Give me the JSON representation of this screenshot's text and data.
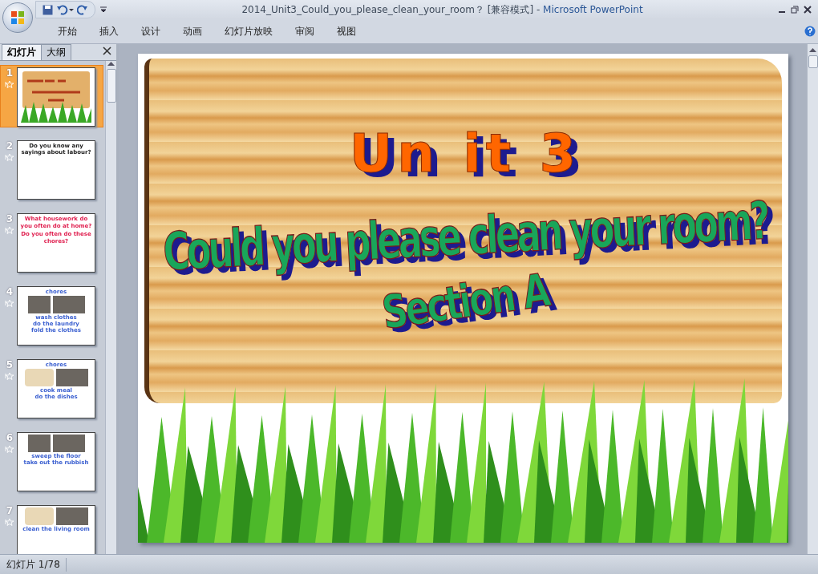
{
  "window": {
    "title": "2014_Unit3_Could_you_please_clean_your_room？ [兼容模式]",
    "separator": "-",
    "app": "Microsoft PowerPoint"
  },
  "ribbon_tabs": [
    {
      "label": "开始"
    },
    {
      "label": "插入"
    },
    {
      "label": "设计"
    },
    {
      "label": "动画"
    },
    {
      "label": "幻灯片放映"
    },
    {
      "label": "审阅"
    },
    {
      "label": "视图"
    }
  ],
  "pane_tabs": [
    {
      "label": "幻灯片",
      "selected": true
    },
    {
      "label": "大纲",
      "selected": false
    }
  ],
  "thumbnails": [
    {
      "number": "1",
      "selected": true,
      "kind": "sign"
    },
    {
      "number": "2",
      "selected": false,
      "kind": "text",
      "heading": "Do you know any sayings about labour?"
    },
    {
      "number": "3",
      "selected": false,
      "kind": "text",
      "lines": [
        "What housework do you often do at home?",
        "Do you often do these chores?"
      ]
    },
    {
      "number": "4",
      "selected": false,
      "kind": "photos",
      "heading": "chores",
      "captions": [
        "wash clothes",
        "do the laundry",
        "fold the clothes"
      ]
    },
    {
      "number": "5",
      "selected": false,
      "kind": "photos",
      "heading": "chores",
      "captions": [
        "cook meal",
        "do the dishes"
      ]
    },
    {
      "number": "6",
      "selected": false,
      "kind": "photos",
      "captions": [
        "sweep the floor",
        "take out the rubbish"
      ]
    },
    {
      "number": "7",
      "selected": false,
      "kind": "photos",
      "captions": [
        "clean the living room"
      ]
    }
  ],
  "slide": {
    "unit": "Un it 3",
    "title": "Could you please clean your room?",
    "section": "Section A"
  },
  "status_bar": {
    "slide_counter": "幻灯片 1/78"
  }
}
